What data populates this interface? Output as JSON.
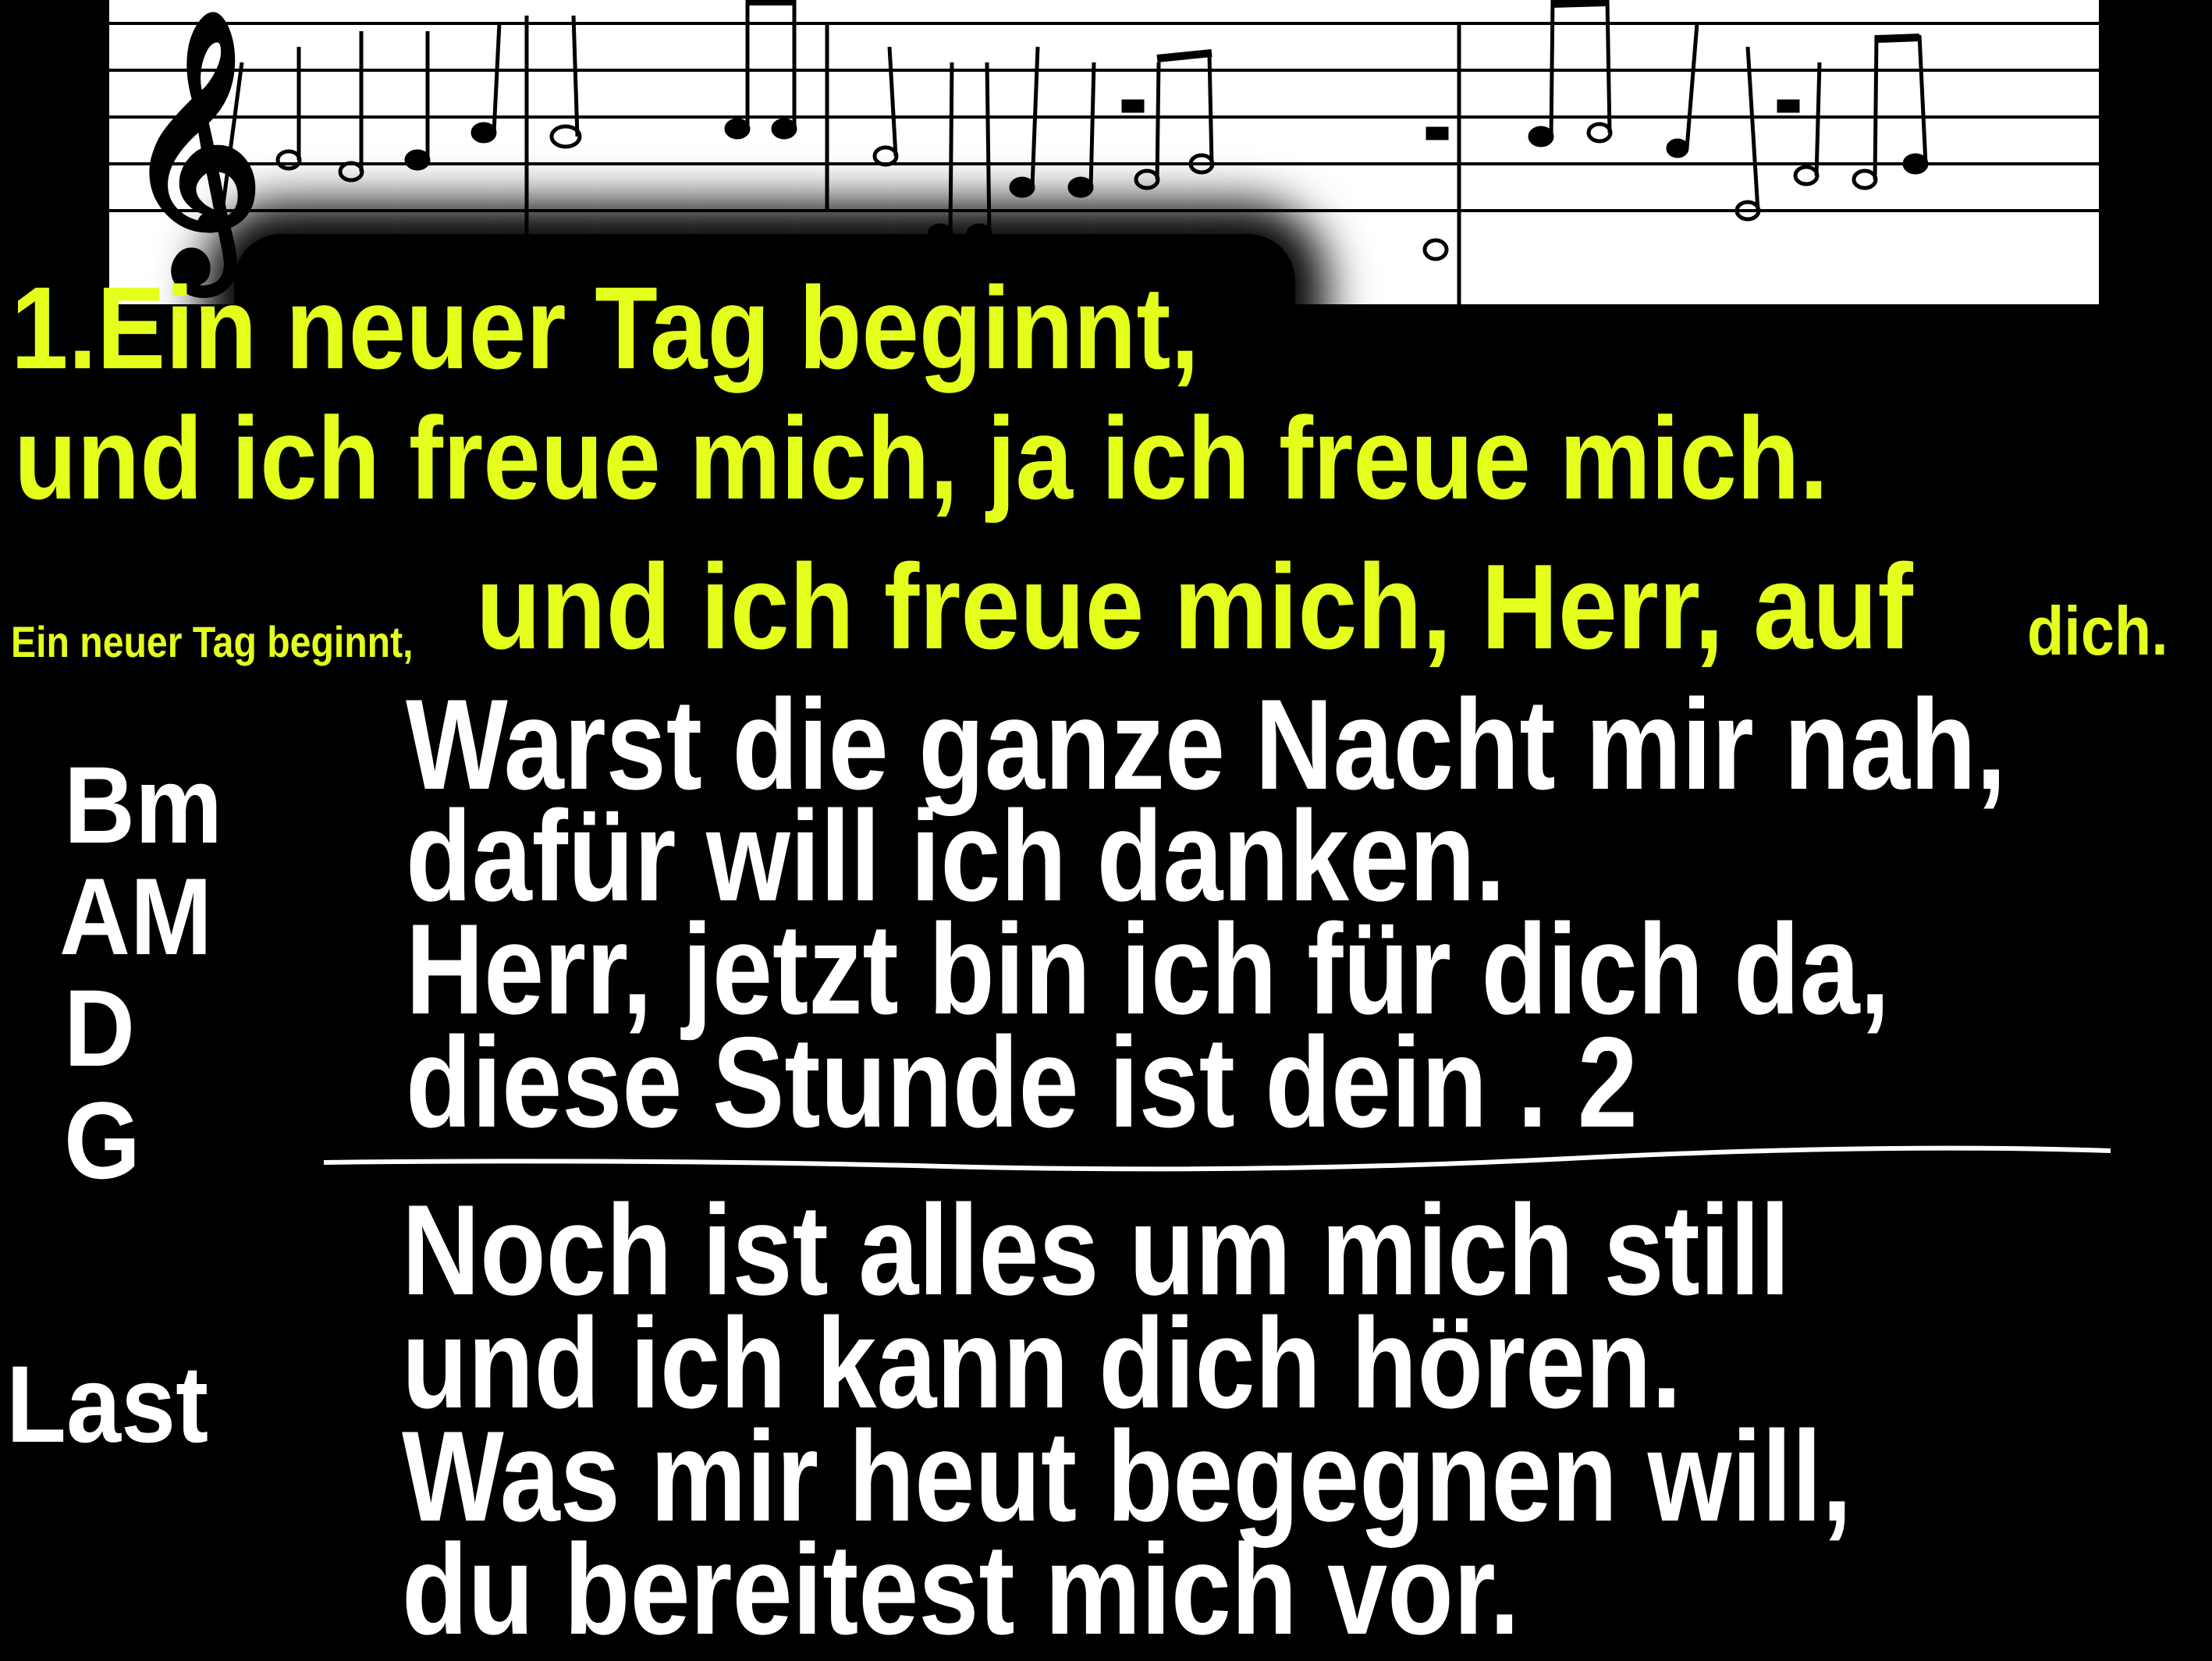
{
  "colors": {
    "background": "#000000",
    "refrain_text": "#e4ff1c",
    "verse_text": "#ffffff",
    "sheet_paper": "#ffffff",
    "sheet_ink": "#000000"
  },
  "sheet_music": {
    "clef": "treble-clef"
  },
  "refrain": {
    "line1": "1.Ein neuer Tag beginnt,",
    "line2": "und ich freue mich, ja ich freue mich.",
    "line3_small": "Ein neuer Tag beginnt,",
    "line3_main": "und ich freue mich, Herr, auf",
    "line3_end": "dich."
  },
  "chords": [
    "Bm",
    "AM",
    "D",
    "G"
  ],
  "verse_a": [
    "Warst die ganze Nacht mir nah,",
    "dafür will ich danken.",
    "Herr, jetzt bin ich für dich da,",
    "diese Stunde ist dein . 2"
  ],
  "last_label": "Last",
  "verse_b": [
    "Noch ist alles um mich still",
    "und ich kann dich hören.",
    "Was mir heut begegnen will,",
    "du bereitest mich vor."
  ]
}
